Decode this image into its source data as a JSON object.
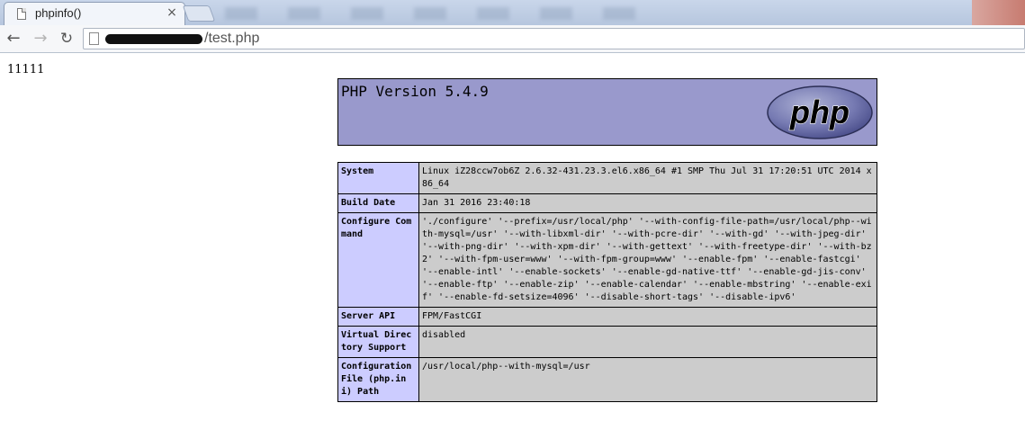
{
  "browser": {
    "tab_title": "phpinfo()",
    "tab_close": "×",
    "nav": {
      "back": "←",
      "forward": "→",
      "reload": "↻"
    },
    "url_suffix": "/test.php"
  },
  "page": {
    "echo_text": "11111",
    "php_version": "PHP Version 5.4.9",
    "rows": [
      {
        "key": "System",
        "value": "Linux iZ28ccw7ob6Z 2.6.32-431.23.3.el6.x86_64 #1 SMP Thu Jul 31 17:20:51 UTC 2014 x86_64"
      },
      {
        "key": "Build Date",
        "value": "Jan 31 2016 23:40:18"
      },
      {
        "key": "Configure Command",
        "value": "'./configure' '--prefix=/usr/local/php' '--with-config-file-path=/usr/local/php--with-mysql=/usr' '--with-libxml-dir' '--with-pcre-dir' '--with-gd' '--with-jpeg-dir' '--with-png-dir' '--with-xpm-dir' '--with-gettext' '--with-freetype-dir' '--with-bz2' '--with-fpm-user=www' '--with-fpm-group=www' '--enable-fpm' '--enable-fastcgi' '--enable-intl' '--enable-sockets' '--enable-gd-native-ttf' '--enable-gd-jis-conv' '--enable-ftp' '--enable-zip' '--enable-calendar' '--enable-mbstring' '--enable-exif' '--enable-fd-setsize=4096' '--disable-short-tags' '--disable-ipv6'"
      },
      {
        "key": "Server API",
        "value": "FPM/FastCGI"
      },
      {
        "key": "Virtual Directory Support",
        "value": "disabled"
      },
      {
        "key": "Configuration File (php.ini) Path",
        "value": "/usr/local/php--with-mysql=/usr"
      }
    ]
  },
  "colors": {
    "header_bg": "#9999cc",
    "key_bg": "#ccccff",
    "value_bg": "#cccccc"
  }
}
